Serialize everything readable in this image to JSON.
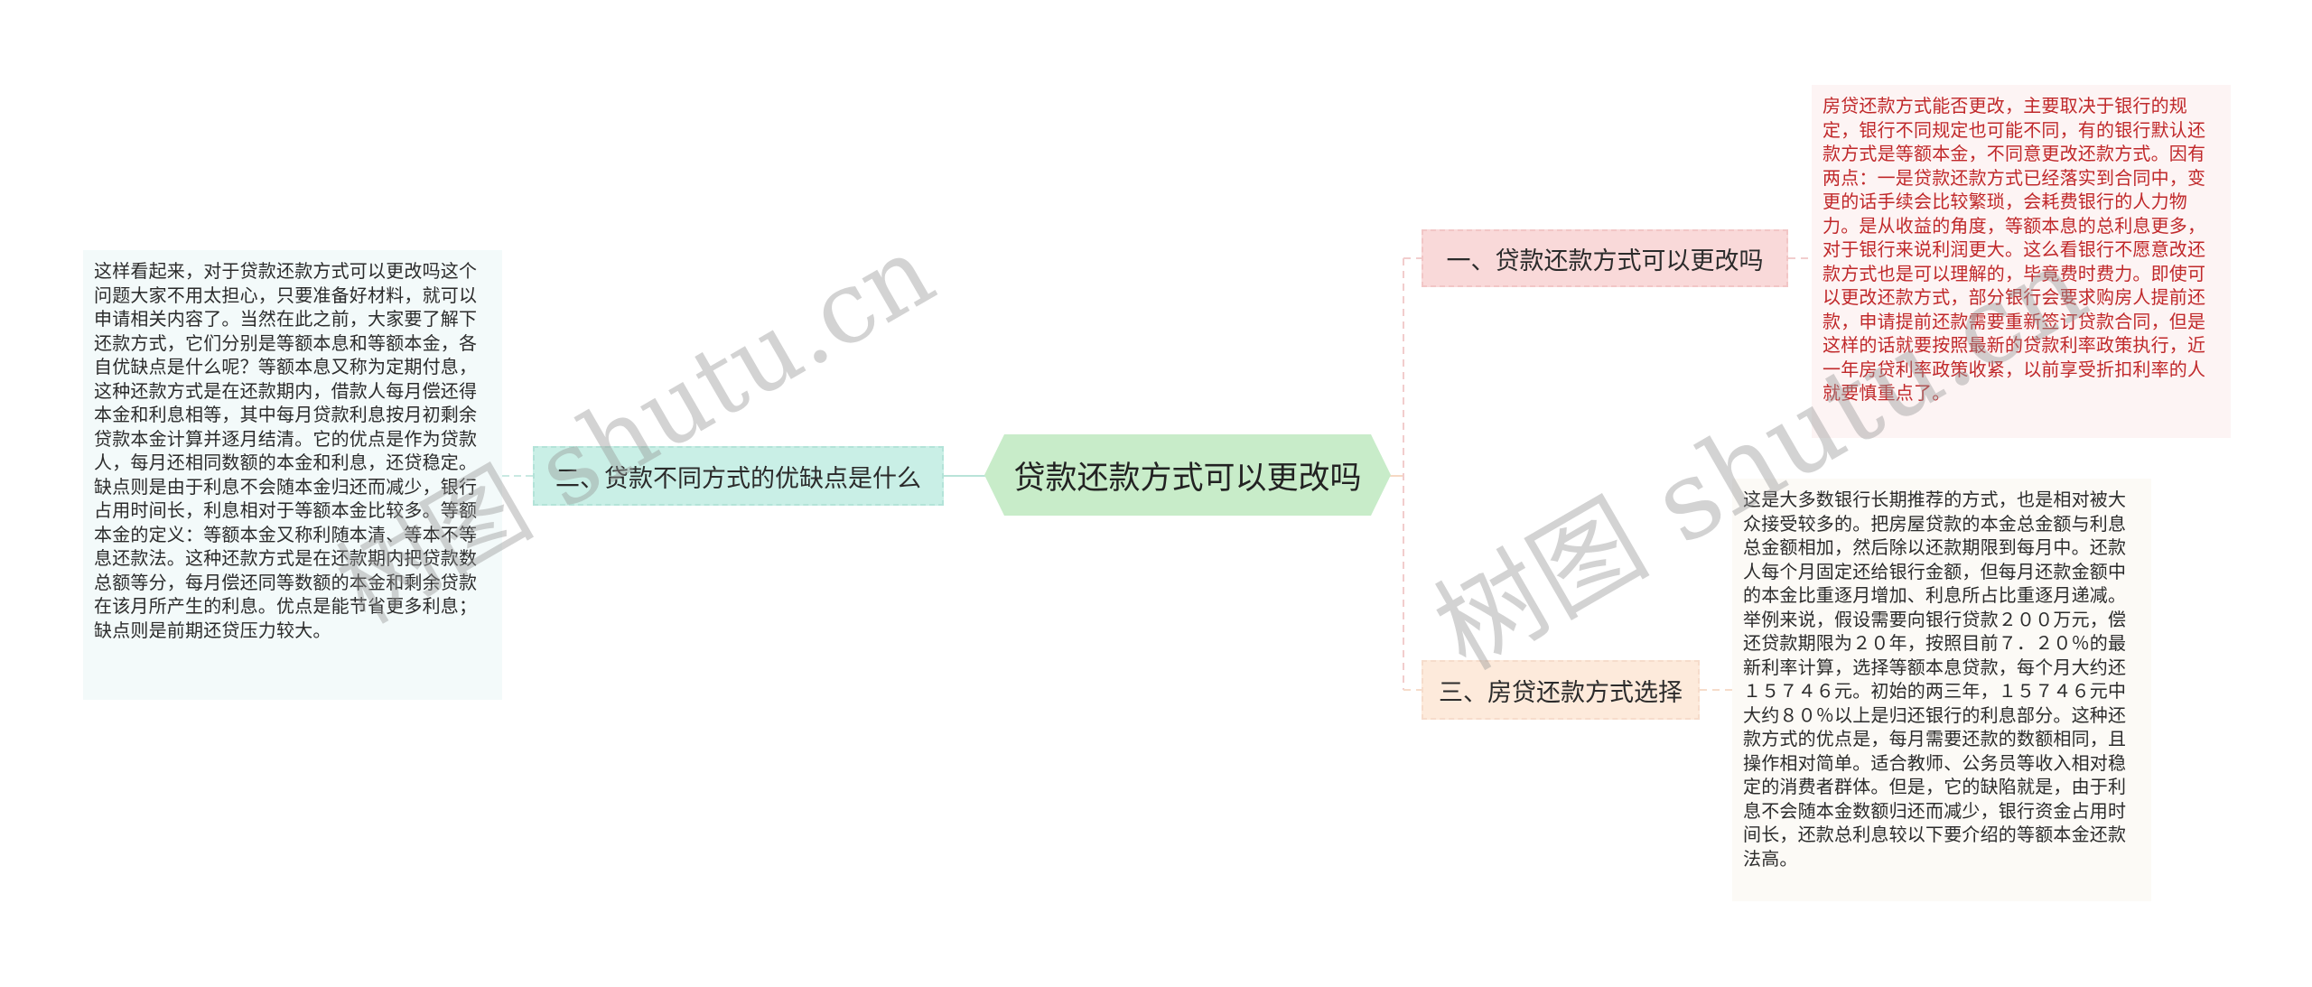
{
  "diagram": {
    "title": "贷款还款方式可以更改吗",
    "colors": {
      "center_bg": "#c8ecc9",
      "branch_left_bg": "#c9efe6",
      "branch_top_right_bg": "#f9d9d9",
      "branch_bottom_right_bg": "#fdeadb",
      "red_text": "#c0282a"
    },
    "center": {
      "label": "贷款还款方式可以更改吗"
    },
    "branches": [
      {
        "label": "一、贷款还款方式可以更改吗",
        "side": "right-top",
        "content": "房贷还款方式能否更改，主要取决于银行的规定，银行不同规定也可能不同，有的银行默认还款方式是等额本金，不同意更改还款方式。因有两点：一是贷款还款方式已经落实到合同中，变更的话手续会比较繁琐，会耗费银行的人力物力。是从收益的角度，等额本息的总利息更多，对于银行来说利润更大。这么看银行不愿意改还款方式也是可以理解的，毕竟费时费力。即使可以更改还款方式，部分银行会要求购房人提前还款，申请提前还款需要重新签订贷款合同，但是这样的话就要按照最新的贷款利率政策执行，近一年房贷利率政策收紧，以前享受折扣利率的人就要慎重点了。"
      },
      {
        "label": "二、贷款不同方式的优缺点是什么",
        "side": "left",
        "content": "这样看起来，对于贷款还款方式可以更改吗这个问题大家不用太担心，只要准备好材料，就可以申请相关内容了。当然在此之前，大家要了解下还款方式，它们分别是等额本息和等额本金，各自优缺点是什么呢？等额本息又称为定期付息，这种还款方式是在还款期内，借款人每月偿还得本金和利息相等，其中每月贷款利息按月初剩余贷款本金计算并逐月结清。它的优点是作为贷款人，每月还相同数额的本金和利息，还贷稳定。缺点则是由于利息不会随本金归还而减少，银行占用时间长，利息相对于等额本金比较多。等额本金的定义：等额本金又称利随本清、等本不等息还款法。这种还款方式是在还款期内把贷款数总额等分，每月偿还同等数额的本金和剩余贷款在该月所产生的利息。优点是能节省更多利息；缺点则是前期还贷压力较大。"
      },
      {
        "label": "三、房贷还款方式选择",
        "side": "right-bottom",
        "content": "这是大多数银行长期推荐的方式，也是相对被大众接受较多的。把房屋贷款的本金总金额与利息总金额相加，然后除以还款期限到每月中。还款人每个月固定还给银行金额，但每月还款金额中的本金比重逐月增加、利息所占比重逐月递减。举例来说，假设需要向银行贷款２００万元，偿还贷款期限为２０年，按照目前７．２０％的最新利率计算，选择等额本息贷款，每个月大约还１５７４６元。初始的两三年，１５７４６元中大约８０％以上是归还银行的利息部分。这种还款方式的优点是，每月需要还款的数额相同，且操作相对简单。适合教师、公务员等收入相对稳定的消费者群体。但是，它的缺陷就是，由于利息不会随本金数额归还而减少，银行资金占用时间长，还款总利息较以下要介绍的等额本金还款法高。"
      }
    ],
    "watermarks": [
      "树图 shutu.cn",
      "树图 shutu.cn"
    ]
  }
}
